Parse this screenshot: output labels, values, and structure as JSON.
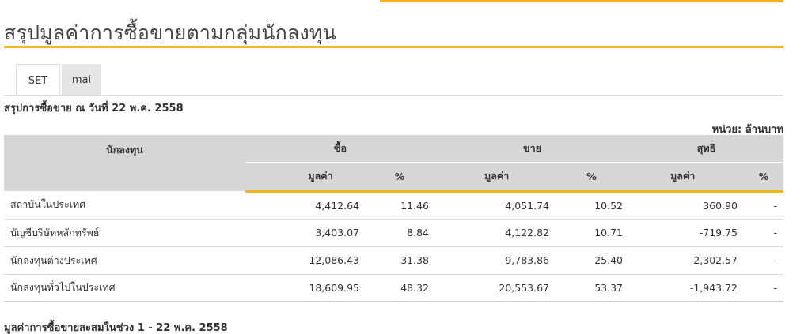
{
  "page": {
    "title": "สรุปมูลค่าการซื้อขายตามกลุ่มนักลงทุน"
  },
  "tabs": [
    {
      "label": "SET",
      "active": true
    },
    {
      "label": "mai",
      "active": false
    }
  ],
  "summary_date_label": "สรุปการซื้อขาย ณ วันที่ 22 พ.ค. 2558",
  "unit_label": "หน่วย: ล้านบาท",
  "table": {
    "header": {
      "investor": "นักลงทุน",
      "buy": "ซื้อ",
      "sell": "ขาย",
      "net": "สุทธิ"
    },
    "subheader": {
      "buy_value": "มูลค่า",
      "buy_pct": "%",
      "sell_value": "มูลค่า",
      "sell_pct": "%",
      "net_value": "มูลค่า",
      "net_pct": "%"
    },
    "rows": [
      {
        "investor": "สถาบันในประเทศ",
        "buy_value": "4,412.64",
        "buy_pct": "11.46",
        "sell_value": "4,051.74",
        "sell_pct": "10.52",
        "net_value": "360.90",
        "net_pct": "-"
      },
      {
        "investor": "บัญชีบริษัทหลักทรัพย์",
        "buy_value": "3,403.07",
        "buy_pct": "8.84",
        "sell_value": "4,122.82",
        "sell_pct": "10.71",
        "net_value": "-719.75",
        "net_pct": "-"
      },
      {
        "investor": "นักลงทุนต่างประเทศ",
        "buy_value": "12,086.43",
        "buy_pct": "31.38",
        "sell_value": "9,783.86",
        "sell_pct": "25.40",
        "net_value": "2,302.57",
        "net_pct": "-"
      },
      {
        "investor": "นักลงทุนทั่วไปในประเทศ",
        "buy_value": "18,609.95",
        "buy_pct": "48.32",
        "sell_value": "20,553.67",
        "sell_pct": "53.37",
        "net_value": "-1,943.72",
        "net_pct": "-"
      }
    ]
  },
  "cumulative_label": "มูลค่าการซื้อขายสะสมในช่วง 1 - 22 พ.ค. 2558",
  "colors": {
    "accent": "#f5b323",
    "positive": "#2e8b2e",
    "negative": "#e02020",
    "header_bg": "#d6d6d6"
  }
}
